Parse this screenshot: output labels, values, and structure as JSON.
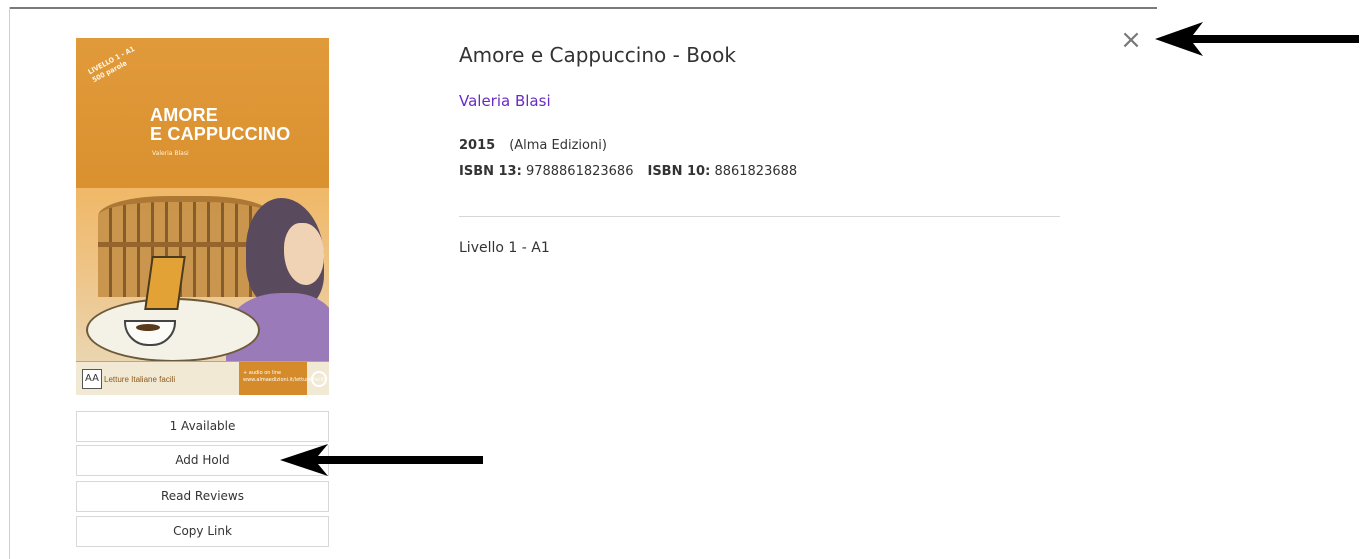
{
  "book": {
    "cover": {
      "ribbon": "LIVELLO 1 - A1\n500 parole",
      "title_line1": "AMORE",
      "title_line2": "E CAPPUCCINO",
      "author": "Valeria Blasi",
      "series": "Letture Italiane facili",
      "audio_note": "+ audio on line\nwww.almaedizioni.it/letture-facili",
      "logo": "AA"
    },
    "title": "Amore e Cappuccino - Book",
    "author": "Valeria Blasi",
    "year": "2015",
    "publisher": "(Alma Edizioni)",
    "isbn13_label": "ISBN 13:",
    "isbn13": "9788861823686",
    "isbn10_label": "ISBN 10:",
    "isbn10": "8861823688",
    "description": "Livello 1 - A1"
  },
  "actions": {
    "available": "1 Available",
    "add_hold": "Add Hold",
    "read_reviews": "Read Reviews",
    "copy_link": "Copy Link"
  },
  "close_icon": "×",
  "colors": {
    "author_link": "#6a2bc4",
    "cover_orange": "#d9902f",
    "arrow": "#000000"
  },
  "icons": [
    "close-icon",
    "annotation-arrow"
  ]
}
